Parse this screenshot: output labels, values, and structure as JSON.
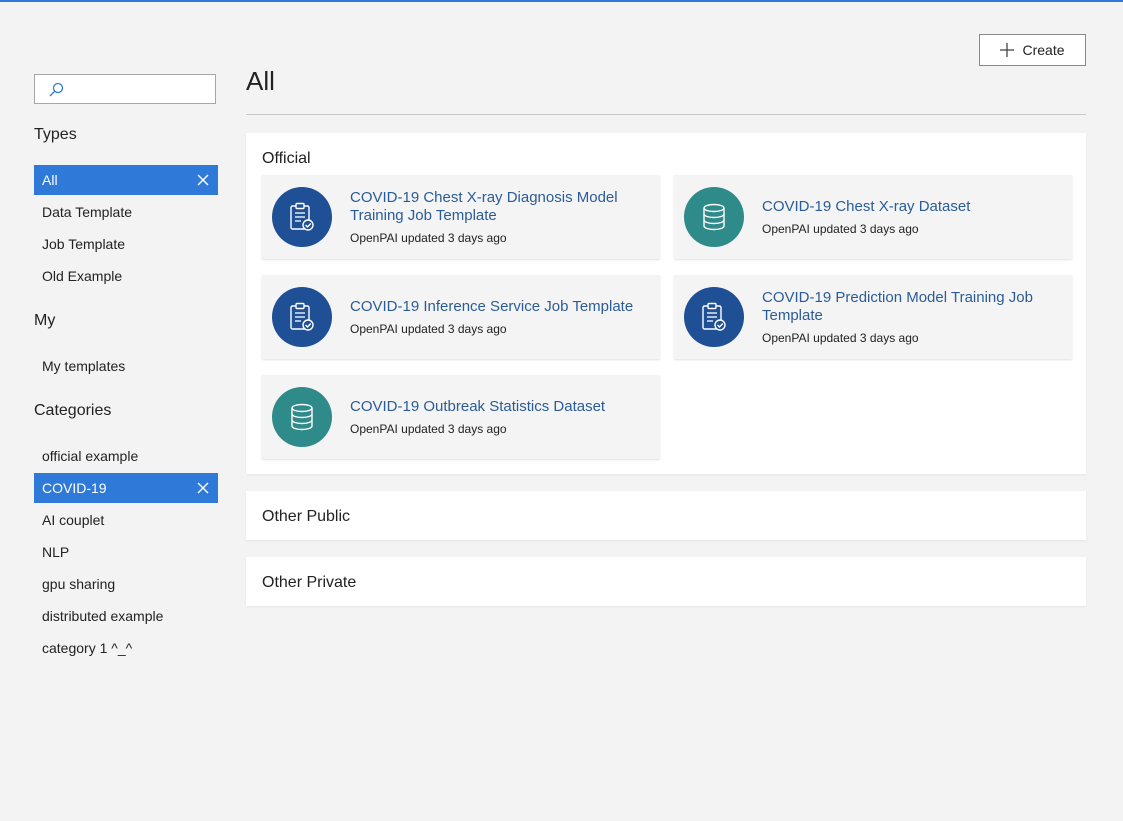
{
  "search": {
    "placeholder": "",
    "value": ""
  },
  "sidebar": {
    "types_title": "Types",
    "types": [
      {
        "label": "All",
        "selected": true
      },
      {
        "label": "Data Template",
        "selected": false
      },
      {
        "label": "Job Template",
        "selected": false
      },
      {
        "label": "Old Example",
        "selected": false
      }
    ],
    "my_title": "My",
    "my": [
      {
        "label": "My templates"
      }
    ],
    "categories_title": "Categories",
    "categories": [
      {
        "label": "official example",
        "selected": false
      },
      {
        "label": "COVID-19",
        "selected": true
      },
      {
        "label": "AI couplet",
        "selected": false
      },
      {
        "label": "NLP",
        "selected": false
      },
      {
        "label": "gpu sharing",
        "selected": false
      },
      {
        "label": "distributed example",
        "selected": false
      },
      {
        "label": "category 1 ^_^",
        "selected": false
      }
    ]
  },
  "header": {
    "title": "All",
    "create_label": "Create"
  },
  "official": {
    "title": "Official",
    "cards": [
      {
        "title": "COVID-19 Chest X-ray Diagnosis Model Training Job Template",
        "meta": "OpenPAI updated 3 days ago",
        "icon": "clipboard-check-icon"
      },
      {
        "title": "COVID-19 Chest X-ray Dataset",
        "meta": "OpenPAI updated 3 days ago",
        "icon": "database-icon"
      },
      {
        "title": "COVID-19 Inference Service Job Template",
        "meta": "OpenPAI updated 3 days ago",
        "icon": "clipboard-check-icon"
      },
      {
        "title": "COVID-19 Prediction Model Training Job Template",
        "meta": "OpenPAI updated 3 days ago",
        "icon": "clipboard-check-icon"
      },
      {
        "title": "COVID-19 Outbreak Statistics Dataset",
        "meta": "OpenPAI updated 3 days ago",
        "icon": "database-icon"
      }
    ]
  },
  "other_public": {
    "title": "Other Public"
  },
  "other_private": {
    "title": "Other Private"
  },
  "colors": {
    "accent": "#2f7ad8",
    "template_icon_bg": "#1f4f94",
    "data_icon_bg": "#2f8a8a",
    "link": "#2b5c98"
  }
}
